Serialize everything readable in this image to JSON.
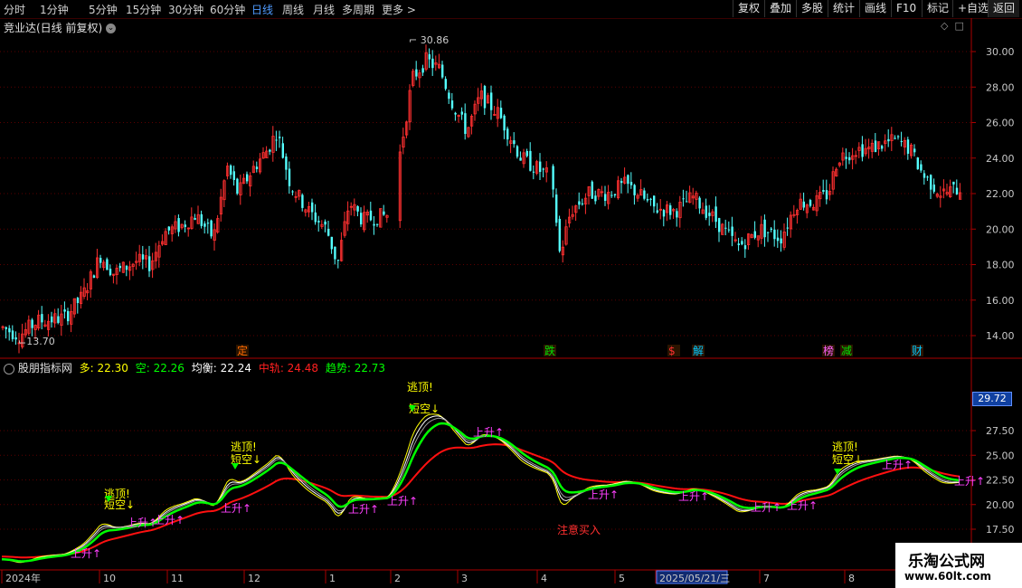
{
  "toolbar": {
    "periods": [
      "分时",
      "1分钟",
      "5分钟",
      "15分钟",
      "30分钟",
      "60分钟",
      "日线",
      "周线",
      "月线",
      "多周期",
      "更多 >"
    ],
    "active_period": "日线",
    "buttons": [
      "复权",
      "叠加",
      "多股",
      "统计",
      "画线",
      "F10",
      "标记",
      "+自选",
      "返回"
    ]
  },
  "main_panel": {
    "title": "竞业达(日线 前复权)",
    "y_ticks": [
      "30.00",
      "28.00",
      "26.00",
      "24.00",
      "22.00",
      "20.00",
      "18.00",
      "16.00",
      "14.00"
    ],
    "high_label": "30.86",
    "low_label": "13.70",
    "event_marks": [
      {
        "text": "定",
        "color": "#ff6a00"
      },
      {
        "text": "跌",
        "color": "#00e000"
      },
      {
        "text": "$",
        "color": "#ff3030"
      },
      {
        "text": "解",
        "color": "#00c8ff"
      },
      {
        "text": "榜",
        "color": "#ff60ff"
      },
      {
        "text": "减",
        "color": "#00e000"
      },
      {
        "text": "财",
        "color": "#00c8ff"
      }
    ]
  },
  "indicator_panel": {
    "name": "股朋指标网",
    "values": [
      {
        "label": "多: 22.30",
        "color": "#ffff00"
      },
      {
        "label": "空: 22.26",
        "color": "#00ff00"
      },
      {
        "label": "均衡: 22.24",
        "color": "#ffffff"
      },
      {
        "label": "中轨: 24.48",
        "color": "#ff2020"
      },
      {
        "label": "趋势: 22.73",
        "color": "#00ff00"
      }
    ],
    "y_ticks": [
      "27.50",
      "25.00",
      "22.50",
      "20.00",
      "17.50"
    ],
    "current_value": "29.72",
    "annotations": {
      "escape_top": "逃顶!",
      "short": "短空↓",
      "rise": "上升↑",
      "buy_note": "注意买入"
    }
  },
  "x_axis": {
    "labels": [
      "2024年",
      "10",
      "11",
      "12",
      "1",
      "2",
      "3",
      "4",
      "5",
      "2025/05/21/三",
      "7",
      "8"
    ]
  },
  "watermark": {
    "title": "乐淘公式网",
    "url": "www.60lt.com"
  },
  "colors": {
    "up": "#ff3030",
    "down": "#54ffff",
    "grid": "#5a0000",
    "axis": "#aa0000"
  }
}
